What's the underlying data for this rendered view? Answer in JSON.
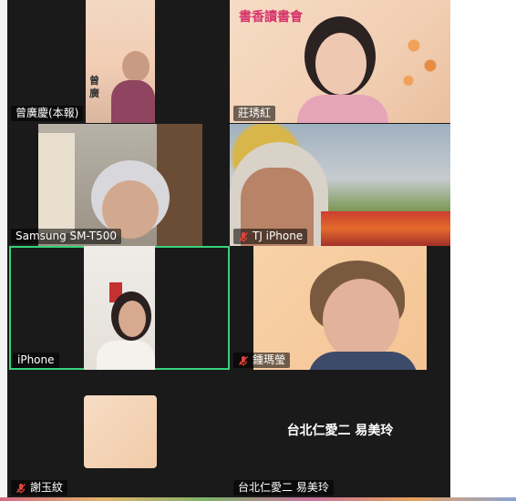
{
  "participants": [
    {
      "id": "t1",
      "name": "曾廣慶(本報)",
      "muted": false,
      "overlay_text": "曾廣"
    },
    {
      "id": "t2",
      "name": "莊琇紅",
      "muted": false,
      "banner_text": "書香讀書會"
    },
    {
      "id": "t3",
      "name": "Samsung SM-T500",
      "muted": false
    },
    {
      "id": "t4",
      "name": "TJ iPhone",
      "muted": true
    },
    {
      "id": "t5",
      "name": "iPhone",
      "muted": false,
      "active_speaker": true
    },
    {
      "id": "t6",
      "name": "鍾瑪瑩",
      "muted": true
    },
    {
      "id": "t7",
      "name": "謝玉紋",
      "muted": true,
      "video_off": true
    },
    {
      "id": "t8",
      "name": "台北仁愛二 易美玲",
      "muted": false,
      "video_off": true,
      "nameplate": "台北仁愛二 易美玲"
    }
  ],
  "colors": {
    "active_border": "#36d27b",
    "muted_icon": "#e0433b",
    "tile_bg": "#1a1a1a"
  }
}
